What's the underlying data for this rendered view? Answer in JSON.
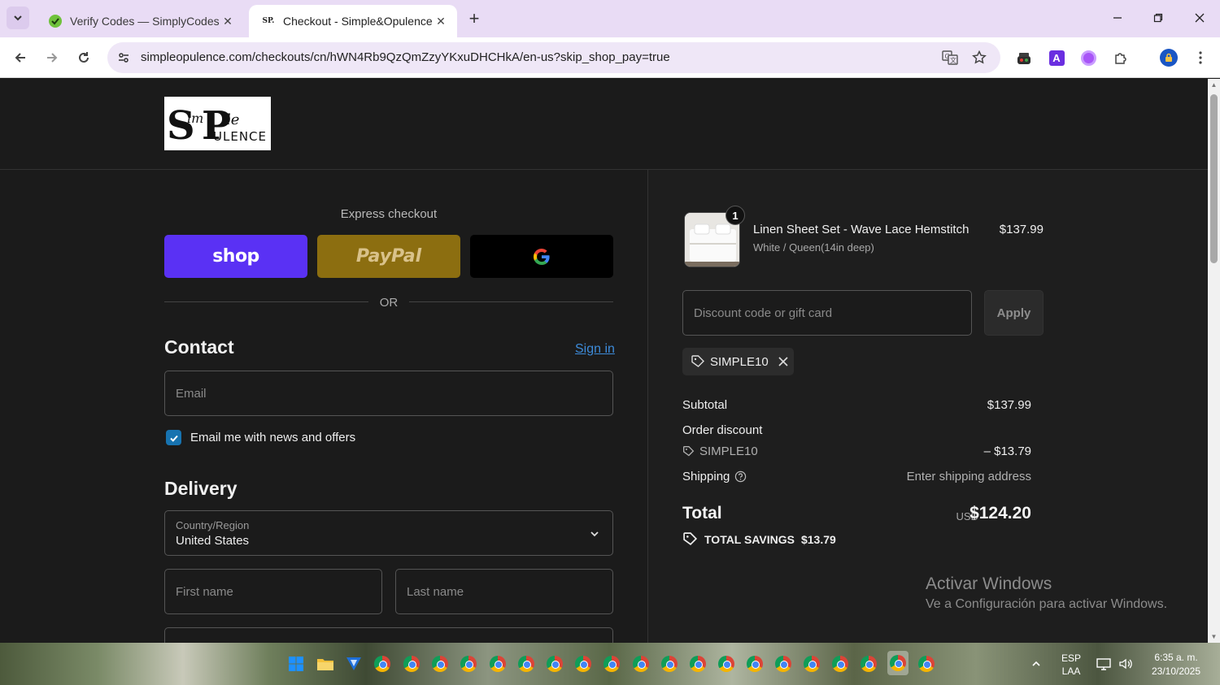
{
  "browser": {
    "tabs": [
      {
        "title": "Verify Codes — SimplyCodes",
        "active": false
      },
      {
        "title": "Checkout - Simple&Opulence",
        "active": true
      }
    ],
    "url": "simpleopulence.com/checkouts/cn/hWN4Rb9QzQmZzyYKxuDHCHkA/en-us?skip_shop_pay=true"
  },
  "checkout": {
    "express_title": "Express checkout",
    "shop_label": "shop",
    "paypal_label": "PayPal",
    "or_label": "OR",
    "contact_title": "Contact",
    "sign_in": "Sign in",
    "email_placeholder": "Email",
    "news_label": "Email me with news and offers",
    "news_checked": true,
    "delivery_title": "Delivery",
    "country_label": "Country/Region",
    "country_value": "United States",
    "first_name_placeholder": "First name",
    "last_name_placeholder": "Last name"
  },
  "summary": {
    "product": {
      "name": "Linen Sheet Set - Wave Lace Hemstitch",
      "variant": "White / Queen(14in deep)",
      "price": "$137.99",
      "quantity": "1"
    },
    "discount_placeholder": "Discount code or gift card",
    "apply_label": "Apply",
    "applied_code": "SIMPLE10",
    "subtotal_label": "Subtotal",
    "subtotal_value": "$137.99",
    "order_discount_label": "Order discount",
    "discount_code": "SIMPLE10",
    "discount_value": "– $13.79",
    "shipping_label": "Shipping",
    "shipping_value": "Enter shipping address",
    "total_label": "Total",
    "currency": "USD",
    "total_value": "$124.20",
    "savings_label": "TOTAL SAVINGS",
    "savings_value": "$13.79"
  },
  "watermark": {
    "title": "Activar Windows",
    "subtitle": "Ve a Configuración para activar Windows."
  },
  "taskbar": {
    "lang_line1": "ESP",
    "lang_line2": "LAA",
    "time": "6:35 a. m.",
    "date": "23/10/2025"
  },
  "colors": {
    "shop": "#5a31f4",
    "paypal": "#8c6e10",
    "link": "#3d8bd9",
    "checkbox": "#1773b0"
  }
}
